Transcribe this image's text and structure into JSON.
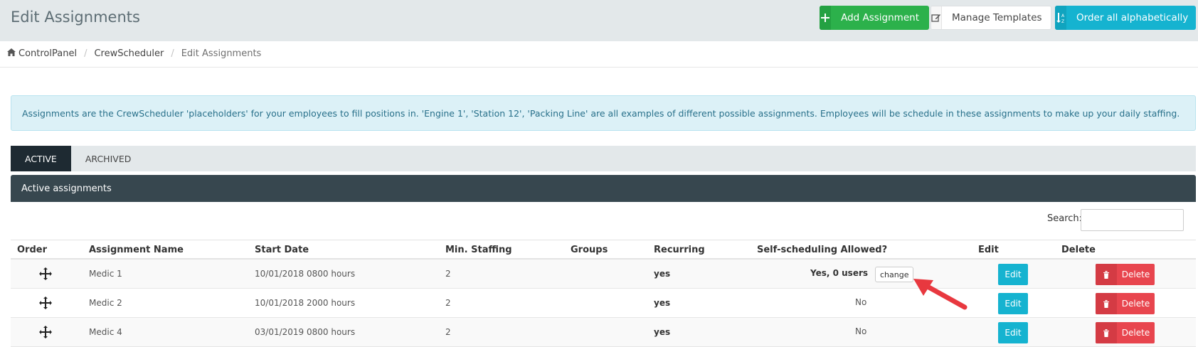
{
  "header": {
    "title": "Edit Assignments",
    "add_label": "Add Assignment",
    "templates_label": "Manage Templates",
    "order_label": "Order all alphabetically"
  },
  "breadcrumb": {
    "items": [
      "ControlPanel",
      "CrewScheduler",
      "Edit Assignments"
    ]
  },
  "info_text": "Assignments are the CrewScheduler 'placeholders' for your employees to fill positions in. 'Engine 1', 'Station 12', 'Packing Line' are all examples of different possible assignments. Employees will be schedule in these assignments to make up your daily staffing.",
  "tabs": [
    {
      "label": "ACTIVE",
      "active": true
    },
    {
      "label": "ARCHIVED",
      "active": false
    }
  ],
  "panel_title": "Active assignments",
  "search": {
    "label": "Search:",
    "value": ""
  },
  "table": {
    "headers": {
      "order": "Order",
      "name": "Assignment Name",
      "start": "Start Date",
      "min": "Min. Staffing",
      "groups": "Groups",
      "recurring": "Recurring",
      "self": "Self-scheduling Allowed?",
      "edit": "Edit",
      "delete": "Delete"
    },
    "rows": [
      {
        "name": "Medic 1",
        "start": "10/01/2018 0800 hours",
        "min": "2",
        "groups": "",
        "recurring": "yes",
        "self": "Yes, 0 users",
        "change": "change",
        "edit": "Edit",
        "delete": "Delete"
      },
      {
        "name": "Medic 2",
        "start": "10/01/2018 2000 hours",
        "min": "2",
        "groups": "",
        "recurring": "yes",
        "self": "No",
        "edit": "Edit",
        "delete": "Delete"
      },
      {
        "name": "Medic 4",
        "start": "03/01/2019 0800 hours",
        "min": "2",
        "groups": "",
        "recurring": "yes",
        "self": "No",
        "edit": "Edit",
        "delete": "Delete"
      }
    ]
  },
  "colors": {
    "success": "#2cb14b",
    "info": "#15b3d0",
    "danger": "#e8454e",
    "panel": "#37474f",
    "arrow": "#e8383f"
  },
  "icons": {
    "add": "plus-icon",
    "templates": "edit-icon",
    "order": "sort-alpha-icon",
    "home": "home-icon",
    "move": "move-icon",
    "delete": "trash-icon"
  }
}
